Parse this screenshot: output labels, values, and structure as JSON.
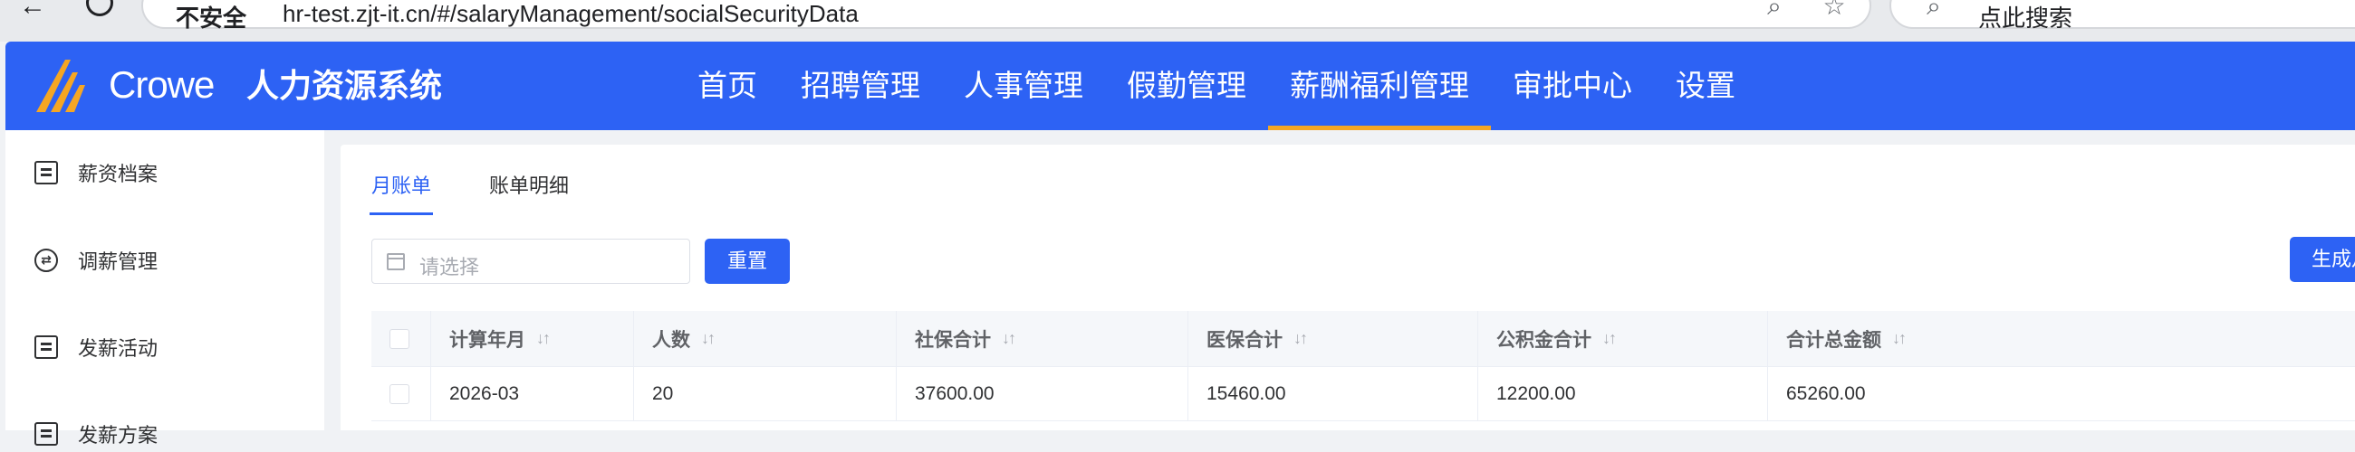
{
  "browser": {
    "security_label": "不安全",
    "url": "hr-test.zjt-it.cn/#/salaryManagement/socialSecurityData",
    "search_placeholder": "点此搜索"
  },
  "header": {
    "brand": "Crowe",
    "title": "人力资源系统",
    "accent_color": "#2d62f4",
    "active_indicator_color": "#f5a623",
    "nav": [
      {
        "label": "首页"
      },
      {
        "label": "招聘管理"
      },
      {
        "label": "人事管理"
      },
      {
        "label": "假勤管理"
      },
      {
        "label": "薪酬福利管理",
        "active": true
      },
      {
        "label": "审批中心"
      },
      {
        "label": "设置"
      }
    ]
  },
  "sidebar": {
    "items": [
      {
        "label": "薪资档案",
        "icon": "document-icon"
      },
      {
        "label": "调薪管理",
        "icon": "swap-icon"
      },
      {
        "label": "发薪活动",
        "icon": "list-icon"
      },
      {
        "label": "发薪方案",
        "icon": "folder-icon"
      }
    ]
  },
  "main": {
    "tabs": [
      {
        "label": "月账单",
        "active": true
      },
      {
        "label": "账单明细",
        "active": false
      }
    ],
    "filter": {
      "date_placeholder": "请选择",
      "reset_label": "重置",
      "generate_label": "生成月"
    },
    "table": {
      "columns": [
        "计算年月",
        "人数",
        "社保合计",
        "医保合计",
        "公积金合计",
        "合计总金额"
      ],
      "rows": [
        [
          "2026-03",
          "20",
          "37600.00",
          "15460.00",
          "12200.00",
          "65260.00"
        ]
      ]
    }
  }
}
